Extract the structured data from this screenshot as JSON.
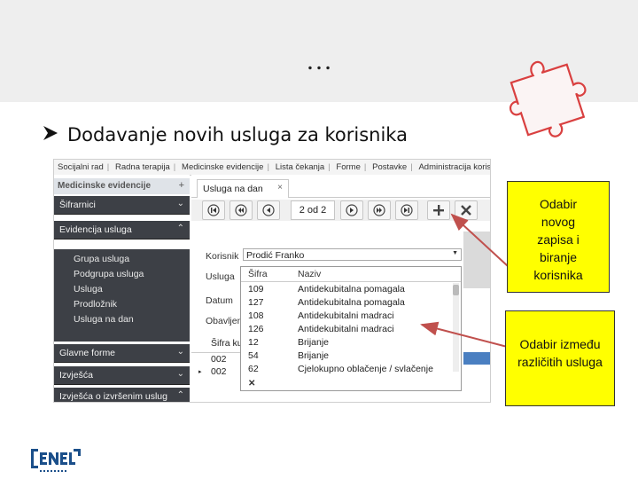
{
  "slide": {
    "ellipsis": "…",
    "bullet_text": "Dodavanje novih usluga za korisnika"
  },
  "app": {
    "menu": [
      "Socijalni rad",
      "Radna terapija",
      "Medicinske evidencije",
      "Lista čekanja",
      "Forme",
      "Postavke",
      "Administracija korisnika"
    ],
    "sidebar": {
      "title": "Medicinske evidencije",
      "title_plus": "+",
      "headers": [
        "Šifrarnici",
        "Evidencija usluga",
        "Glavne forme",
        "Izvješća",
        "Izvješća o izvršenim uslug"
      ],
      "sub_items": [
        "Grupa usluga",
        "Podgrupa usluga",
        "Usluga",
        "Prodložnik",
        "Usluga na dan"
      ]
    },
    "tab": {
      "label": "Usluga na dan",
      "close": "×"
    },
    "pager": "2 od 2",
    "form": {
      "labels": [
        "Korisnik",
        "Usluga",
        "Datum",
        "Obavljen"
      ],
      "korisnik_value": "Prodić Franko",
      "grid_header": "Šifra ku",
      "grid_rows": [
        "002",
        "002"
      ]
    },
    "dropdown": {
      "col_sifra": "Šifra",
      "col_naziv": "Naziv",
      "rows": [
        {
          "sifra": "109",
          "naziv": "Antidekubitalna pomagala"
        },
        {
          "sifra": "127",
          "naziv": "Antidekubitalna pomagala"
        },
        {
          "sifra": "108",
          "naziv": "Antidekubitalni madraci"
        },
        {
          "sifra": "126",
          "naziv": "Antidekubitalni madraci"
        },
        {
          "sifra": "12",
          "naziv": "Brijanje"
        },
        {
          "sifra": "54",
          "naziv": "Brijanje"
        },
        {
          "sifra": "62",
          "naziv": "Cjelokupno oblačenje / svlačenje"
        }
      ],
      "close": "✕"
    }
  },
  "callouts": {
    "first": [
      "Odabir",
      "novog",
      "zapisa i",
      "biranje",
      "korisnika"
    ],
    "second": [
      "Odabir između",
      "različitih usluga"
    ]
  },
  "colors": {
    "callout_bg": "#ffff00",
    "arrow": "#c0504d",
    "sidebar_dark": "#3d4046",
    "selected_combo": "#4dd6c7",
    "logo_blue": "#1b4f8a"
  },
  "logo": {
    "text": "ENEL",
    "tagline": "RAZVOJ IT"
  }
}
